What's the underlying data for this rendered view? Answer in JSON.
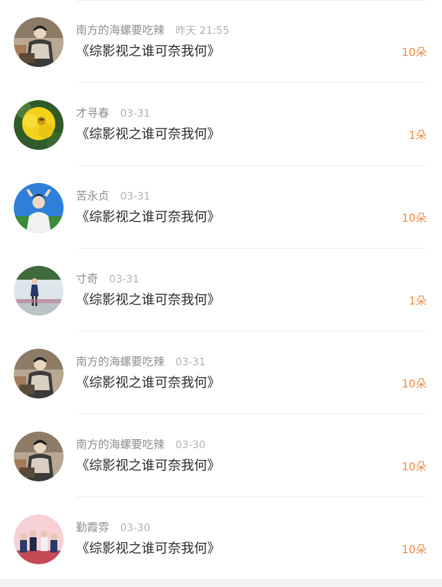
{
  "records": [
    {
      "user": "南方的海螺要吃辣",
      "time": "昨天 21:55",
      "title": "《综影视之谁可奈我何》",
      "gift": "10朵",
      "avatar_icon": "avatar-cartoon-figure-icon"
    },
    {
      "user": "才寻春",
      "time": "03-31",
      "title": "《综影视之谁可奈我何》",
      "gift": "1朵",
      "avatar_icon": "avatar-yellow-flower-icon"
    },
    {
      "user": "苦永贞",
      "time": "03-31",
      "title": "《综影视之谁可奈我何》",
      "gift": "10朵",
      "avatar_icon": "avatar-girl-blue-sky-icon"
    },
    {
      "user": "寸奇",
      "time": "03-31",
      "title": "《综影视之谁可奈我何》",
      "gift": "1朵",
      "avatar_icon": "avatar-standing-figure-icon"
    },
    {
      "user": "南方的海螺要吃辣",
      "time": "03-31",
      "title": "《综影视之谁可奈我何》",
      "gift": "10朵",
      "avatar_icon": "avatar-cartoon-figure-icon"
    },
    {
      "user": "南方的海螺要吃辣",
      "time": "03-30",
      "title": "《综影视之谁可奈我何》",
      "gift": "10朵",
      "avatar_icon": "avatar-cartoon-figure-icon"
    },
    {
      "user": "勤霞雰",
      "time": "03-30",
      "title": "《综影视之谁可奈我何》",
      "gift": "10朵",
      "avatar_icon": "avatar-group-photo-icon"
    }
  ],
  "colors": {
    "accent": "#ef8b45",
    "username": "#8e8e8e",
    "time": "#b3b3b3",
    "title": "#2c2c2c",
    "divider": "#eeeeee"
  }
}
